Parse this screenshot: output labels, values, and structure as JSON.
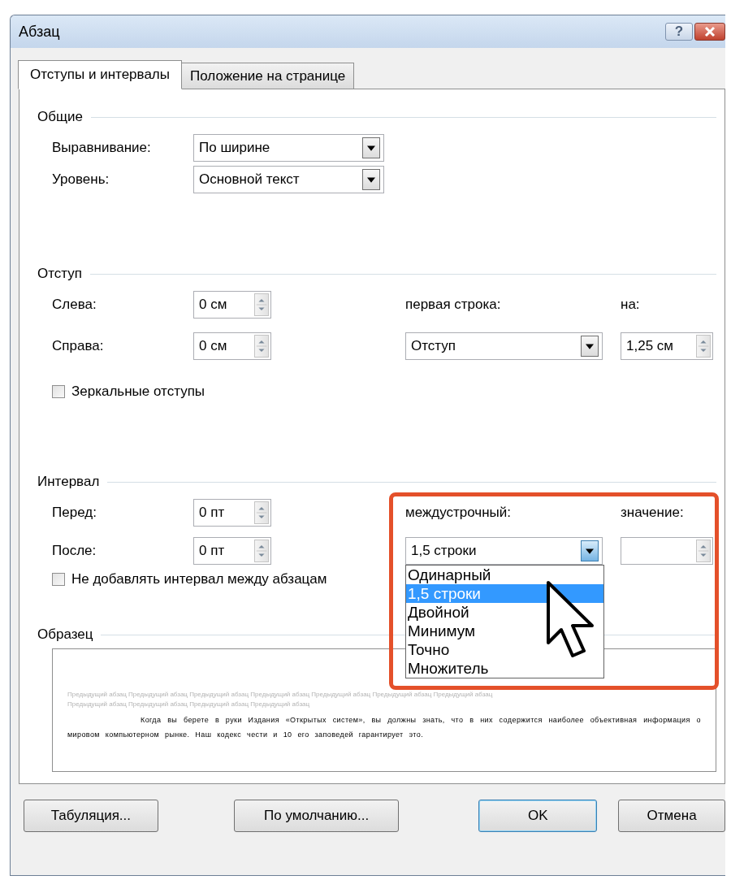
{
  "window": {
    "title": "Абзац",
    "help_label": "?"
  },
  "tabs": [
    {
      "label": "Отступы и интервалы",
      "selected": true
    },
    {
      "label": "Положение на странице",
      "selected": false
    }
  ],
  "general": {
    "title": "Общие",
    "alignment": {
      "label": "Выравнивание:",
      "value": "По ширине"
    },
    "level": {
      "label": "Уровень:",
      "value": "Основной текст"
    }
  },
  "indent": {
    "title": "Отступ",
    "left": {
      "label": "Слева:",
      "value": "0 см"
    },
    "right": {
      "label": "Справа:",
      "value": "0 см"
    },
    "first_line": {
      "label": "первая строка:",
      "value": "Отступ"
    },
    "by": {
      "label": "на:",
      "value": "1,25 см"
    },
    "mirror": {
      "label": "Зеркальные отступы",
      "checked": false
    }
  },
  "spacing": {
    "title": "Интервал",
    "before": {
      "label": "Перед:",
      "value": "0 пт"
    },
    "after": {
      "label": "После:",
      "value": "0 пт"
    },
    "line_spacing": {
      "label": "междустрочный:",
      "value": "1,5 строки",
      "expanded": true,
      "options": [
        {
          "label": "Одинарный",
          "selected": false
        },
        {
          "label": "1,5 строки",
          "selected": true
        },
        {
          "label": "Двойной",
          "selected": false
        },
        {
          "label": "Минимум",
          "selected": false
        },
        {
          "label": "Точно",
          "selected": false
        },
        {
          "label": "Множитель",
          "selected": false
        }
      ]
    },
    "at": {
      "label": "значение:"
    },
    "no_space": {
      "label": "Не добавлять интервал между абзацам",
      "checked": false
    }
  },
  "preview": {
    "title": "Образец",
    "previous_text": "Предыдущий абзац Предыдущий абзац Предыдущий абзац Предыдущий абзац Предыдущий абзац Предыдущий абзац Предыдущий абзац Предыдущий абзац Предыдущий абзац Предыдущий абзац Предыдущий абзац",
    "sample_text": "Когда вы берете в руки Издания «Открытых систем», вы должны знать, что в них содержится наиболее объективная информация о мировом компьютерном рынке. Наш кодекс чести и 10 его заповедей гарантирует это."
  },
  "buttons": [
    {
      "label": "Табуляция...",
      "kind": "normal"
    },
    {
      "label": "По умолчанию...",
      "kind": "normal"
    },
    {
      "label": "OK",
      "kind": "default"
    },
    {
      "label": "Отмена",
      "kind": "normal"
    }
  ]
}
